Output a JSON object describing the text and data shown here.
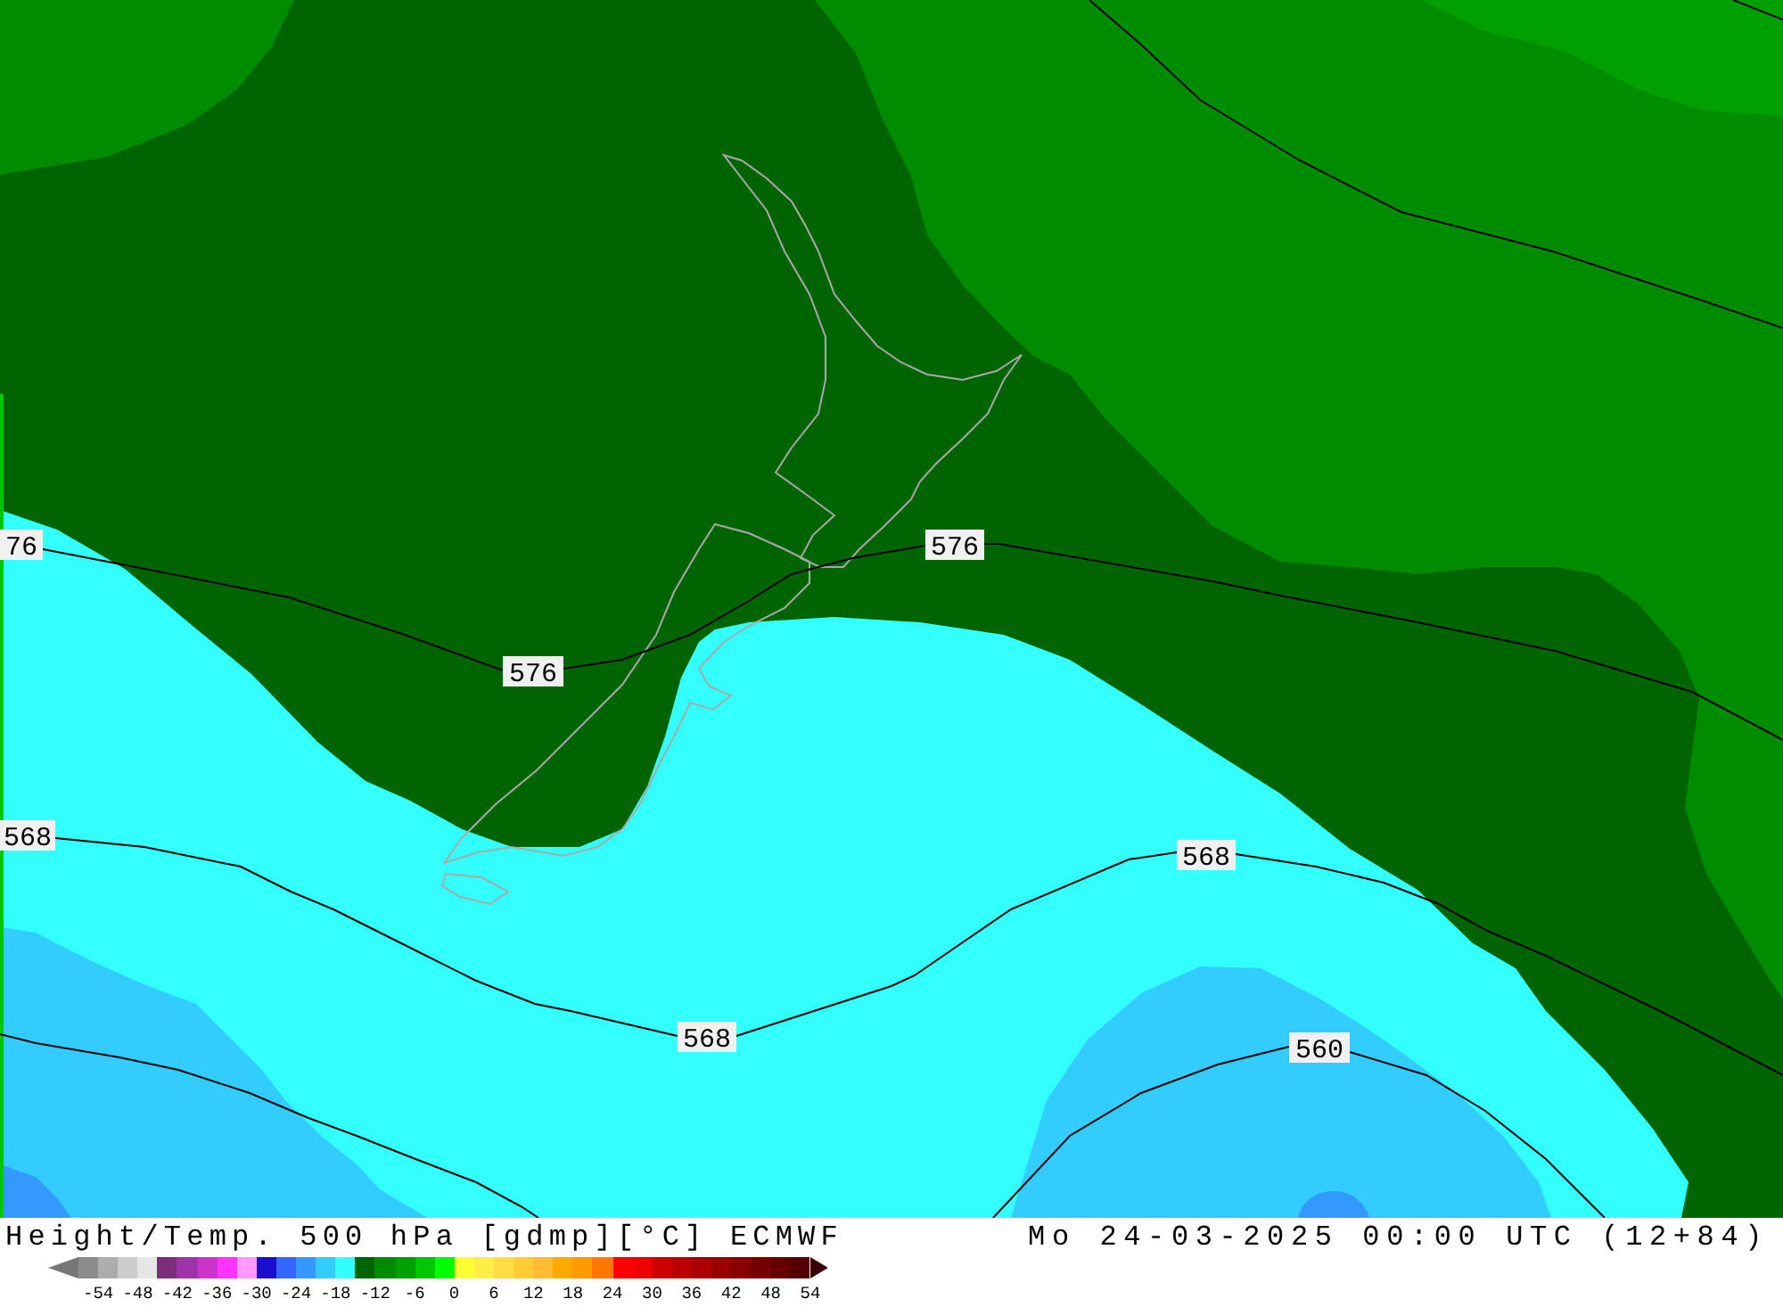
{
  "map": {
    "contours": [
      {
        "labels": [
          "76",
          "576",
          "576"
        ]
      },
      {
        "labels": [
          "568",
          "568",
          "568"
        ]
      },
      {
        "labels": [
          "560"
        ]
      }
    ]
  },
  "footer": {
    "title": "Height/Temp. 500 hPa [gdmp][°C] ECMWF",
    "valid_time": "Mo 24-03-2025 00:00 UTC (12+84)"
  },
  "colorbar": {
    "swatches": [
      {
        "kind": "low-arrow",
        "color": "#777777"
      },
      {
        "kind": "cell",
        "color": "#8c8c8c"
      },
      {
        "kind": "cell",
        "color": "#adadad"
      },
      {
        "kind": "cell",
        "color": "#cccccc"
      },
      {
        "kind": "cell",
        "color": "#e6e6e6"
      },
      {
        "kind": "cell",
        "color": "#7b2f7b"
      },
      {
        "kind": "cell",
        "color": "#a033a8"
      },
      {
        "kind": "cell",
        "color": "#cc33cc"
      },
      {
        "kind": "cell",
        "color": "#ff33ff"
      },
      {
        "kind": "cell",
        "color": "#ff99ff"
      },
      {
        "kind": "cell",
        "color": "#1a0fcc"
      },
      {
        "kind": "cell",
        "color": "#3366ff"
      },
      {
        "kind": "cell",
        "color": "#3399ff"
      },
      {
        "kind": "cell",
        "color": "#33ccff"
      },
      {
        "kind": "cell",
        "color": "#33ffff"
      },
      {
        "kind": "cell",
        "color": "#006400"
      },
      {
        "kind": "cell",
        "color": "#008c00"
      },
      {
        "kind": "cell",
        "color": "#00a000"
      },
      {
        "kind": "cell",
        "color": "#00c800"
      },
      {
        "kind": "cell",
        "color": "#00ff00"
      },
      {
        "kind": "cell",
        "color": "#ffff33"
      },
      {
        "kind": "cell",
        "color": "#ffee44"
      },
      {
        "kind": "cell",
        "color": "#ffdd44"
      },
      {
        "kind": "cell",
        "color": "#ffcc33"
      },
      {
        "kind": "cell",
        "color": "#ffbb33"
      },
      {
        "kind": "cell",
        "color": "#ffaa00"
      },
      {
        "kind": "cell",
        "color": "#ff9900"
      },
      {
        "kind": "cell",
        "color": "#ff7700"
      },
      {
        "kind": "cell",
        "color": "#ff0000"
      },
      {
        "kind": "cell",
        "color": "#ee0000"
      },
      {
        "kind": "cell",
        "color": "#cc0000"
      },
      {
        "kind": "cell",
        "color": "#bb0000"
      },
      {
        "kind": "cell",
        "color": "#aa0000"
      },
      {
        "kind": "cell",
        "color": "#990000"
      },
      {
        "kind": "cell",
        "color": "#880000"
      },
      {
        "kind": "cell",
        "color": "#770000"
      },
      {
        "kind": "cell",
        "color": "#660000"
      },
      {
        "kind": "cell",
        "color": "#550000"
      },
      {
        "kind": "high-arrow",
        "color": "#3a0000"
      }
    ],
    "ticks": [
      "-54",
      "-48",
      "-42",
      "-36",
      "-30",
      "-24",
      "-18",
      "-12",
      "-6",
      "0",
      "6",
      "12",
      "18",
      "24",
      "30",
      "36",
      "42",
      "48",
      "54"
    ]
  }
}
